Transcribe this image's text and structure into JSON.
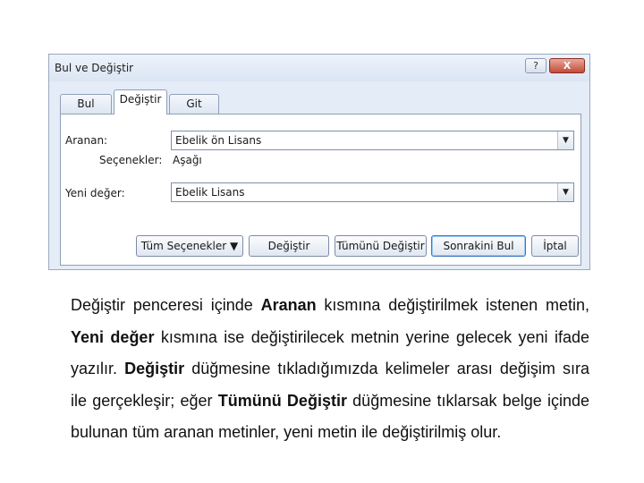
{
  "dialog": {
    "title": "Bul ve Değiştir",
    "help_label": "?",
    "close_label": "X",
    "tabs": [
      {
        "label": "Bul"
      },
      {
        "label": "Değiştir"
      },
      {
        "label": "Git"
      }
    ],
    "find_label": "Aranan:",
    "find_value": "Ebelik ön Lisans",
    "options_label": "Seçenekler:",
    "options_value": "Aşağı",
    "replace_label": "Yeni değer:",
    "replace_value": "Ebelik Lisans",
    "combo_arrow": "▼",
    "buttons": {
      "more": "Tüm Seçenekler ▼",
      "replace": "Değiştir",
      "replace_all": "Tümünü Değiştir",
      "find_next": "Sonrakini Bul",
      "cancel": "İptal"
    }
  },
  "paragraph": [
    {
      "text": "Değiştir penceresi içinde ",
      "bold": false
    },
    {
      "text": "Aranan",
      "bold": true
    },
    {
      "text": " kısmına değiştirilmek istenen metin, ",
      "bold": false
    },
    {
      "text": "Yeni değer",
      "bold": true
    },
    {
      "text": " kısmına ise değiştirilecek metnin yerine gelecek yeni ifade yazılır. ",
      "bold": false
    },
    {
      "text": "Değiştir",
      "bold": true
    },
    {
      "text": " düğmesine tıkladığımızda kelimeler arası değişim sıra ile gerçekleşir; eğer ",
      "bold": false
    },
    {
      "text": "Tümünü Değiştir",
      "bold": true
    },
    {
      "text": " düğmesine tıklarsak belge içinde bulunan tüm aranan metinler, yeni metin ile değiştirilmiş olur.",
      "bold": false
    }
  ]
}
